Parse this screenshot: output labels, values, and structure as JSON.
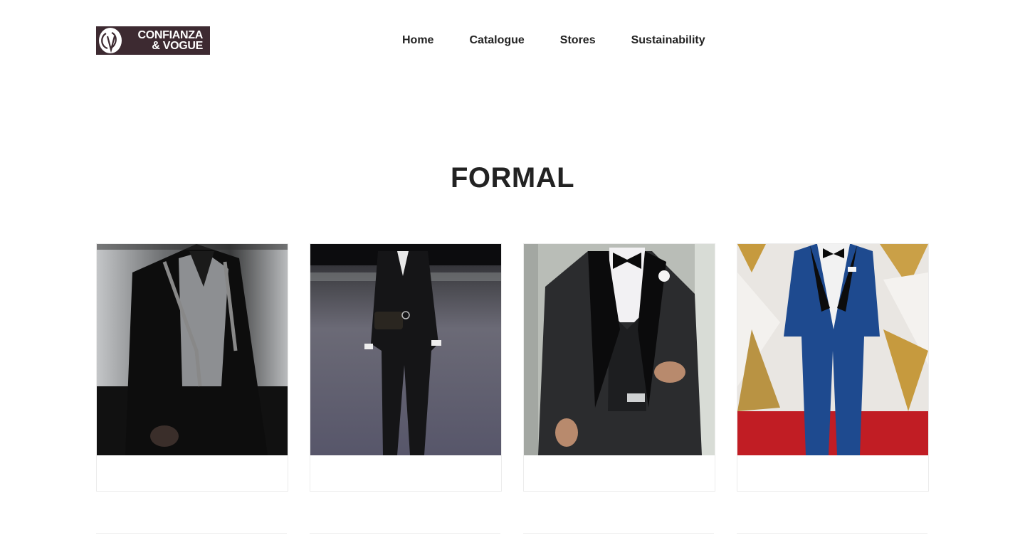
{
  "brand": {
    "logo_line1": "CONFIANZA",
    "logo_line2": "& VOGUE",
    "logo_bg": "#3d2a31"
  },
  "nav": {
    "items": [
      {
        "label": "Home"
      },
      {
        "label": "Catalogue"
      },
      {
        "label": "Stores"
      },
      {
        "label": "Sustainability"
      }
    ]
  },
  "section": {
    "title": "FORMAL"
  },
  "products": [
    {
      "image": "grey-vest-black-suit-photo",
      "caption": ""
    },
    {
      "image": "runway-double-breasted-suit-photo",
      "caption": ""
    },
    {
      "image": "black-tuxedo-bowtie-photo",
      "caption": ""
    },
    {
      "image": "blue-tuxedo-red-carpet-photo",
      "caption": ""
    }
  ]
}
